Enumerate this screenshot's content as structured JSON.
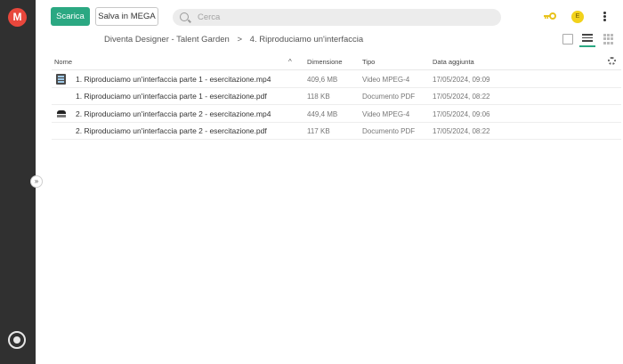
{
  "app": {
    "logo_letter": "M"
  },
  "toolbar": {
    "download_label": "Scarica",
    "save_label": "Salva in MEGA"
  },
  "search": {
    "placeholder": "Cerca",
    "value": ""
  },
  "user": {
    "avatar_initial": "E",
    "avatar_color": "#f2d21b"
  },
  "breadcrumb": {
    "items": [
      "Diventa Designer - Talent Garden",
      "4. Riproduciamo un'interfaccia"
    ],
    "separator": ">"
  },
  "table": {
    "columns": {
      "name": "Nome",
      "size": "Dimensione",
      "type": "Tipo",
      "date": "Data aggiunta"
    },
    "rows": [
      {
        "name": "1. Riproduciamo un'interfaccia parte 1 - esercitazione.mp4",
        "size": "409,6 MB",
        "type": "Video MPEG-4",
        "date": "17/05/2024, 09:09",
        "icon": "video-file-icon"
      },
      {
        "name": "1. Riproduciamo un'interfaccia parte 1 - esercitazione.pdf",
        "size": "118 KB",
        "type": "Documento PDF",
        "date": "17/05/2024, 08:22",
        "icon": ""
      },
      {
        "name": "2. Riproduciamo un'interfaccia parte 2 - esercitazione.mp4",
        "size": "449,4 MB",
        "type": "Video MPEG-4",
        "date": "17/05/2024, 09:06",
        "icon": "video-file-icon"
      },
      {
        "name": "2. Riproduciamo un'interfaccia parte 2 - esercitazione.pdf",
        "size": "117 KB",
        "type": "Documento PDF",
        "date": "17/05/2024, 08:22",
        "icon": ""
      }
    ]
  },
  "colors": {
    "accent": "#2ba882",
    "rail": "#303030",
    "logo": "#e8473c",
    "key": "#e8c21a"
  }
}
